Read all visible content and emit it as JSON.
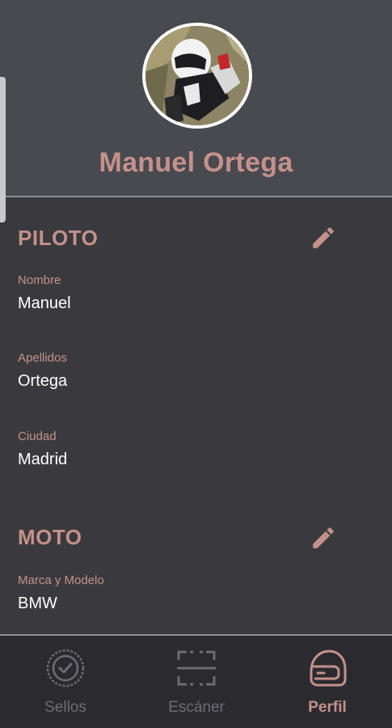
{
  "profile": {
    "name": "Manuel Ortega"
  },
  "piloto": {
    "title": "PILOTO",
    "fields": [
      {
        "label": "Nombre",
        "value": "Manuel"
      },
      {
        "label": "Apellidos",
        "value": "Ortega"
      },
      {
        "label": "Ciudad",
        "value": "Madrid"
      }
    ]
  },
  "moto": {
    "title": "MOTO",
    "fields": [
      {
        "label": "Marca y Modelo",
        "value": "BMW"
      }
    ]
  },
  "nav": {
    "items": [
      {
        "label": "Sellos",
        "icon": "seal-icon",
        "active": false
      },
      {
        "label": "Escáner",
        "icon": "scanner-icon",
        "active": false
      },
      {
        "label": "Perfil",
        "icon": "helmet-icon",
        "active": true
      }
    ]
  },
  "colors": {
    "accent": "#c4918b",
    "header_bg": "#494950",
    "content_bg": "#3a3a3e",
    "nav_bg": "#2b2b2f"
  }
}
